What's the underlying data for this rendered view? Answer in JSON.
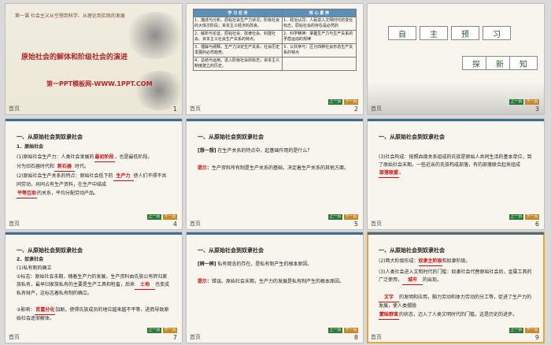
{
  "slides": [
    {
      "num": "1",
      "header_strip": "第一课  社会主义从空想到科学、从理论到实践的发展",
      "title": "原始社会的解体和阶级社会的演进",
      "subtitle": "第一PPT模板网-WWW.1PPT.COM"
    },
    {
      "num": "2",
      "table_headers": [
        "学 习 任 务",
        "核 心 素 养"
      ],
      "table_rows": [
        [
          "1．描述与分析。原始社会生产力状况；阶级社会的大体次阶段；资本主义经济的改良。",
          "1．政治认同：人民进入文明时代的变化标志，原始社会的存在是必然的"
        ],
        [
          "2．解析与论证。原始社会、奴隶社会、封建社会、资本主义社会生产关系的特点。",
          "2．科学精神：掌握生产力与生产关系的矛盾运动的规律"
        ],
        [
          "3．理解与阐释。生产力决定生产关系；社会历史发展的必然趋势。",
          "3．公共参与：区分四种社会形态生产关系的特点"
        ],
        [
          "4．总结与运用。进入阶级社会的标志；资本主义制度建立的历史。",
          ""
        ]
      ]
    },
    {
      "num": "3",
      "btn_chars": [
        "自",
        "主",
        "预",
        "习"
      ],
      "btn_chars2": [
        "探",
        "新",
        "知"
      ]
    },
    {
      "num": "4",
      "section": "一、从原始社会到奴隶社会",
      "sub": "1．原始社会",
      "lines": [
        {
          "pre": "(1)原始社会生产力：人类社会发展的",
          "blank": "最初阶段",
          "post": "，也是最低阶段。"
        },
        {
          "pre": "分为旧石器时代和",
          "blank": "新石器",
          "post": "时代。"
        },
        {
          "pre": "(2)原始社会生产关系的特点：原始社会低下的",
          "blank": "生产力",
          "post": "使人们不得不共同劳动，共同占有生产资料，在生产中结成"
        },
        {
          "pre": "",
          "blank": "平等互助",
          "post": "的关系，平均分配劳动产品。"
        }
      ]
    },
    {
      "num": "5",
      "section": "一、从原始社会到奴隶社会",
      "q_label": "[想一想]",
      "q_text": "在生产关系的特点中，起基础作用的是什么？",
      "a_label": "提示：",
      "a_text": "生产资料所有制是生产关系的基础，决定着生产关系的其他方面。"
    },
    {
      "num": "6",
      "section": "一、从原始社会到奴隶社会",
      "lines": [
        {
          "pre": "(3)社会构成：按照血缘关系组成的氏族是原始人共同生活的基本单位，到了原始社会末期，一些近亲的氏族构成部落，有的部落联合起来组成",
          "blank": "部落联盟",
          "post": "。"
        }
      ]
    },
    {
      "num": "7",
      "section": "一、从原始社会到奴隶社会",
      "sub": "2．奴隶社会",
      "sub2": "(1)私有制的确立",
      "lines": [
        {
          "pre": "①标志：原始社会末期，随着生产力的发展，生产资料由氏族公有转归家族私有，最早归家族私有的主要是生产工具和牲畜，后来",
          "blank": "土地",
          "post": "也变成私有财产，这标志着私有制的确立。"
        },
        {
          "pre": "②影响：",
          "blank": "贫富分化",
          "post": "加剧，使得氏族成员的地位越来越不平等，进而导致原始社会逐渐解体。"
        }
      ]
    },
    {
      "num": "8",
      "section": "一、从原始社会到奴隶社会",
      "q_label": "[辨一辨]",
      "q_text": "私有观念的存在，是私有制产生的根本原因。",
      "a_label": "提示：",
      "a_text": "错误。原始社会末期，生产力的发展是私有制产生的根本原因。"
    },
    {
      "num": "9",
      "section": "一、从原始社会到奴隶社会",
      "lines": [
        {
          "pre": "(2)两大阶级形成：",
          "blank": "奴隶主阶级",
          "post": "和奴隶阶级。"
        },
        {
          "pre": "(3)人类社会进入文明时代的门槛：奴隶社会代替原始社会后，金属工具的广泛使用，",
          "blank": "城市",
          "post": "的出现，"
        },
        {
          "pre": "",
          "blank": "文字",
          "post": "的发明和应用，脑力劳动和体力劳动的分工等，促进了生产力的发展，使人类摆脱"
        },
        {
          "pre": "",
          "blank": "蒙昧野蛮",
          "post": "的状态，迈入了人类文明时代的门槛，这是历史的进步。"
        }
      ]
    }
  ],
  "footer_tag": "首页",
  "nav_buttons": [
    "上一页",
    "下一页"
  ],
  "colors": {
    "selected_outline": "#e8a63a",
    "accent_red": "#d01010",
    "title_red": "#b3262a"
  }
}
